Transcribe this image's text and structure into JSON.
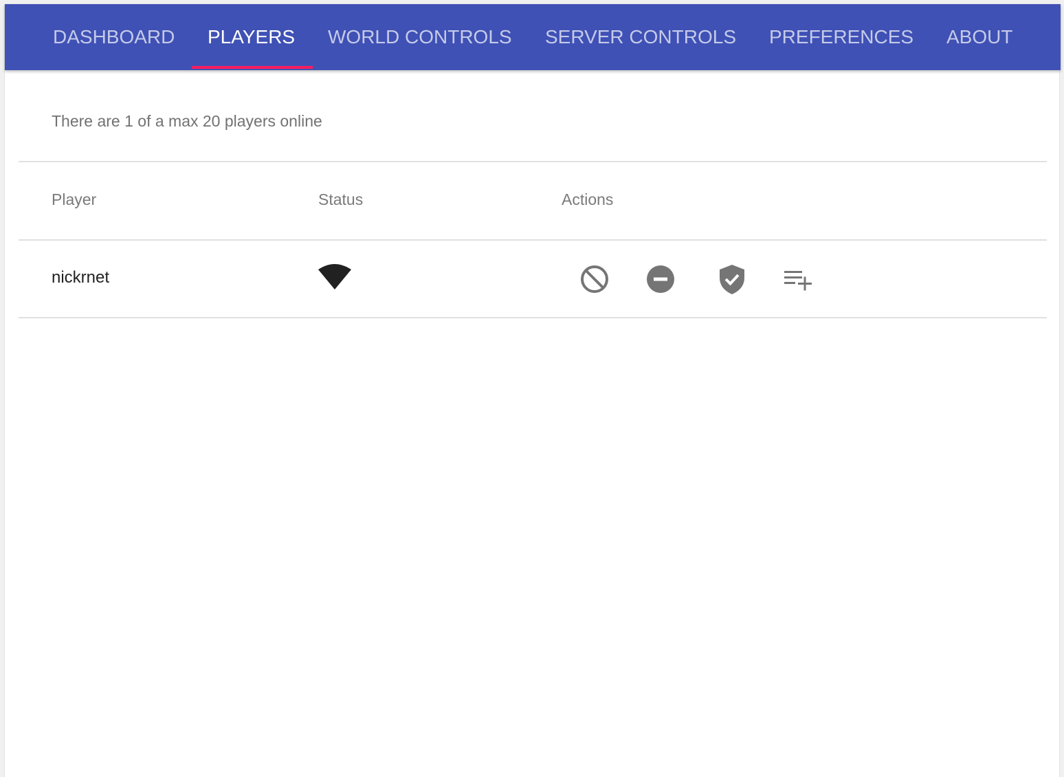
{
  "tabs": [
    {
      "label": "DASHBOARD",
      "active": false
    },
    {
      "label": "PLAYERS",
      "active": true
    },
    {
      "label": "WORLD CONTROLS",
      "active": false
    },
    {
      "label": "SERVER CONTROLS",
      "active": false
    },
    {
      "label": "PREFERENCES",
      "active": false
    },
    {
      "label": "ABOUT",
      "active": false
    }
  ],
  "summary": {
    "text": "There are 1 of a max 20 players online",
    "online": 1,
    "max": 20
  },
  "table": {
    "headers": [
      "Player",
      "Status",
      "Actions"
    ],
    "rows": [
      {
        "player": "nickrnet",
        "status_icon": "wifi-signal-icon",
        "actions": [
          "ban-icon",
          "kick-icon",
          "op-icon",
          "whitelist-add-icon"
        ]
      }
    ]
  },
  "colors": {
    "app_bar": "#3f51b5",
    "tab_inactive": "#c5cae9",
    "tab_active": "#ffffff",
    "tab_indicator": "#ff1d5e",
    "icon_gray": "#757575"
  }
}
